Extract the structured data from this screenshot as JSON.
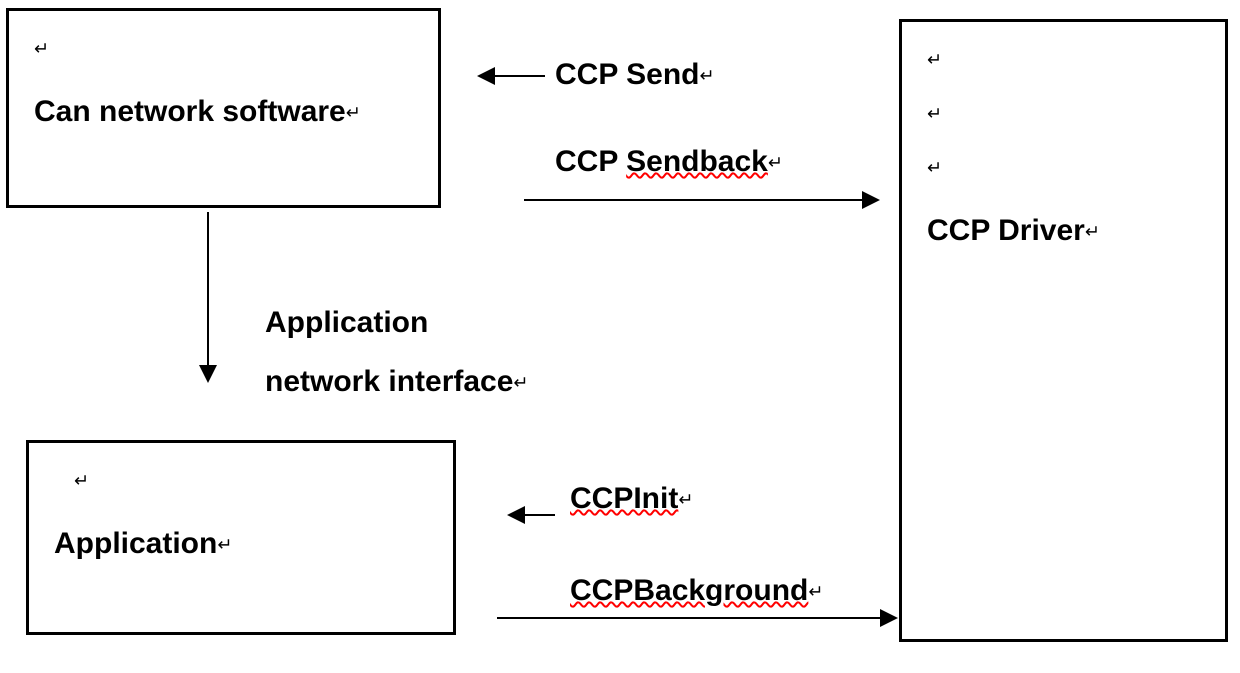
{
  "boxes": {
    "top_left": {
      "text": "Can network software"
    },
    "bottom_left": {
      "text": "Application"
    },
    "right": {
      "text": "CCP Driver"
    }
  },
  "labels": {
    "ccp_send": "CCP Send",
    "ccp_sendback_prefix": "CCP ",
    "ccp_sendback_wavy": "Sendback",
    "app_net_line1": "Application",
    "app_net_line2": "network interface",
    "ccpinit": "CCPInit",
    "ccpbackground": "CCPBackground"
  },
  "marks": {
    "para": "↵"
  }
}
